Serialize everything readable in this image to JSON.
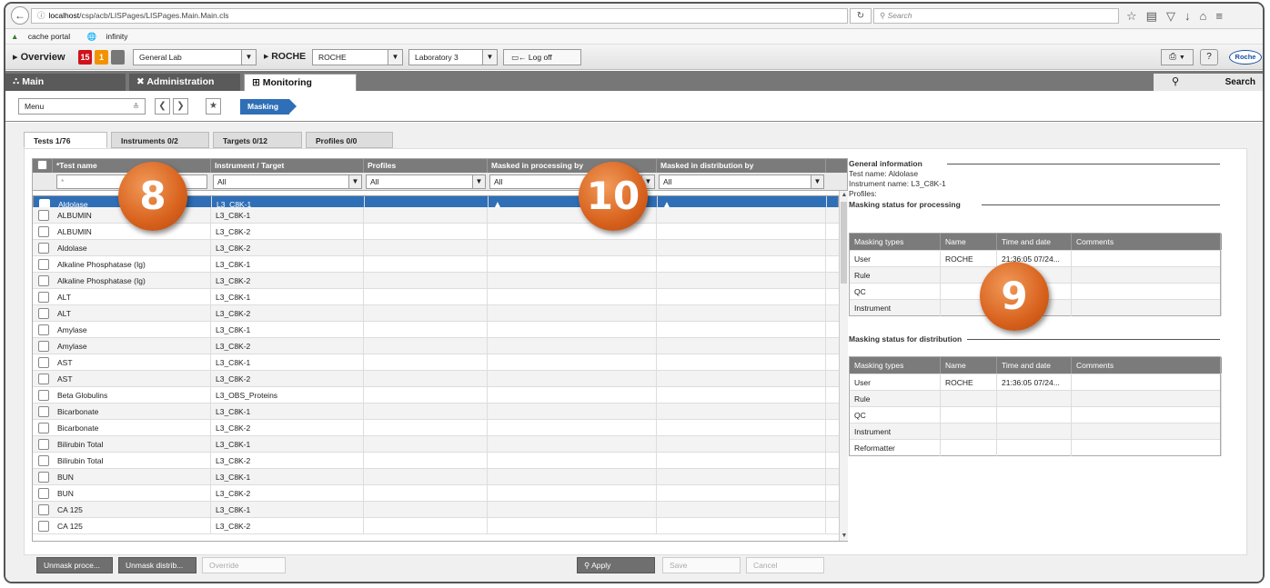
{
  "browser": {
    "url_prefix": "",
    "url_host": "localhost",
    "url_path": "/csp/acb/LISPages/LISPages.Main.Main.cls",
    "search_placeholder": "Search",
    "bookmarks": [
      "cache portal",
      "infinity"
    ]
  },
  "top": {
    "overview_label": "Overview",
    "badge_red": "15",
    "badge_orange": "1",
    "lab_select": "General Lab",
    "user_prefix": "ROCHE",
    "user_select": "ROCHE",
    "laboratory_select": "Laboratory 3",
    "logoff_label": "Log off",
    "brand": "Roche"
  },
  "main_tabs": {
    "main": "Main",
    "administration": "Administration",
    "monitoring": "Monitoring",
    "search": "Search"
  },
  "menu": {
    "label": "Menu",
    "breadcrumb": "Masking"
  },
  "sub_tabs": [
    "Tests 1/76",
    "Instruments 0/2",
    "Targets 0/12",
    "Profiles 0/0"
  ],
  "grid": {
    "columns": [
      "*Test name",
      "Instrument / Target",
      "Profiles",
      "Masked in processing by",
      "Masked in distribution by"
    ],
    "filters": [
      "*",
      "All",
      "All",
      "All",
      "All"
    ],
    "rows": [
      [
        "Aldolase",
        "L3_C8K-1"
      ],
      [
        "ALBUMIN",
        "L3_C8K-1"
      ],
      [
        "ALBUMIN",
        "L3_C8K-2"
      ],
      [
        "Aldolase",
        "L3_C8K-2"
      ],
      [
        "Alkaline Phosphatase (Ig)",
        "L3_C8K-1"
      ],
      [
        "Alkaline Phosphatase (Ig)",
        "L3_C8K-2"
      ],
      [
        "ALT",
        "L3_C8K-1"
      ],
      [
        "ALT",
        "L3_C8K-2"
      ],
      [
        "Amylase",
        "L3_C8K-1"
      ],
      [
        "Amylase",
        "L3_C8K-2"
      ],
      [
        "AST",
        "L3_C8K-1"
      ],
      [
        "AST",
        "L3_C8K-2"
      ],
      [
        "Beta Globulins",
        "L3_OBS_Proteins"
      ],
      [
        "Bicarbonate",
        "L3_C8K-1"
      ],
      [
        "Bicarbonate",
        "L3_C8K-2"
      ],
      [
        "Bilirubin Total",
        "L3_C8K-1"
      ],
      [
        "Bilirubin Total",
        "L3_C8K-2"
      ],
      [
        "BUN",
        "L3_C8K-1"
      ],
      [
        "BUN",
        "L3_C8K-2"
      ],
      [
        "CA 125",
        "L3_C8K-1"
      ],
      [
        "CA 125",
        "L3_C8K-2"
      ]
    ]
  },
  "callouts": [
    "8",
    "9",
    "10"
  ],
  "info": {
    "general_heading": "General information",
    "test_name": "Test name: Aldolase",
    "instrument_name": "Instrument name: L3_C8K-1",
    "profiles": "Profiles:",
    "processing_heading": "Masking status for processing",
    "distribution_heading": "Masking status for distribution",
    "table_headers": [
      "Masking types",
      "Name",
      "Time and date",
      "Comments"
    ],
    "processing_rows": [
      [
        "User",
        "ROCHE",
        "21:36:05 07/24..."
      ],
      [
        "Rule",
        "",
        ""
      ],
      [
        "QC",
        "",
        ""
      ],
      [
        "Instrument",
        "",
        ""
      ]
    ],
    "distribution_rows": [
      [
        "User",
        "ROCHE",
        "21:36:05 07/24..."
      ],
      [
        "Rule",
        "",
        ""
      ],
      [
        "QC",
        "",
        ""
      ],
      [
        "Instrument",
        "",
        ""
      ],
      [
        "Reformatter",
        "",
        ""
      ]
    ]
  },
  "buttons": {
    "unmask_processing": "Unmask proce...",
    "unmask_distribution": "Unmask distrib...",
    "override": "Override",
    "apply": "Apply",
    "save": "Save",
    "cancel": "Cancel"
  }
}
